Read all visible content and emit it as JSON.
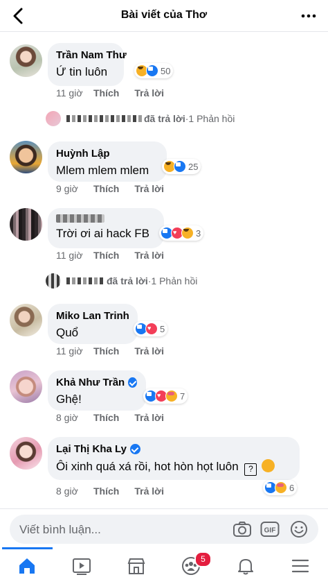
{
  "header": {
    "title": "Bài viết của Thơ"
  },
  "comments": [
    {
      "author": "Trần Nam Thư",
      "text": "Ứ tin luôn",
      "reactions": [
        "haha",
        "like"
      ],
      "reaction_count": "50",
      "time": "11 giờ",
      "like_label": "Thích",
      "reply_label": "Trả lời",
      "verified": false,
      "replies_summary": {
        "action": "đã trả lời",
        "sep": " · ",
        "count": "1 Phản hồi"
      }
    },
    {
      "author": "Huỳnh Lập",
      "text": "Mlem mlem mlem",
      "reactions": [
        "haha",
        "like"
      ],
      "reaction_count": "25",
      "time": "9 giờ",
      "like_label": "Thích",
      "reply_label": "Trả lời",
      "verified": false
    },
    {
      "author": "Mai Gia Lu",
      "text": "Trời ơi ai hack FB",
      "reactions": [
        "like",
        "love",
        "haha"
      ],
      "reaction_count": "3",
      "time": "11 giờ",
      "like_label": "Thích",
      "reply_label": "Trả lời",
      "verified": false,
      "replies_summary": {
        "action": "đã trả lời",
        "sep": " · ",
        "count": "1 Phản hồi"
      }
    },
    {
      "author": "Miko Lan Trinh",
      "text": "Quổ",
      "reactions": [
        "like",
        "love"
      ],
      "reaction_count": "5",
      "time": "11 giờ",
      "like_label": "Thích",
      "reply_label": "Trả lời",
      "verified": false
    },
    {
      "author": "Khả Như Trần",
      "text": "Ghệ!",
      "reactions": [
        "like",
        "love",
        "care"
      ],
      "reaction_count": "7",
      "time": "8 giờ",
      "like_label": "Thích",
      "reply_label": "Trả lời",
      "verified": true
    },
    {
      "author": "Lại Thị Kha Ly",
      "text": "Ôi xinh quá xá rồi, hot hòn họt luôn",
      "reactions": [
        "like",
        "care"
      ],
      "reaction_count": "6",
      "time": "8 giờ",
      "like_label": "Thích",
      "reply_label": "Trả lời",
      "verified": true
    }
  ],
  "composer": {
    "placeholder": "Viết bình luận..."
  },
  "tabbar": {
    "groups_badge": "5"
  },
  "colors": {
    "accent": "#1877f2",
    "bubble": "#f0f2f5",
    "badge": "#e41e3f"
  }
}
